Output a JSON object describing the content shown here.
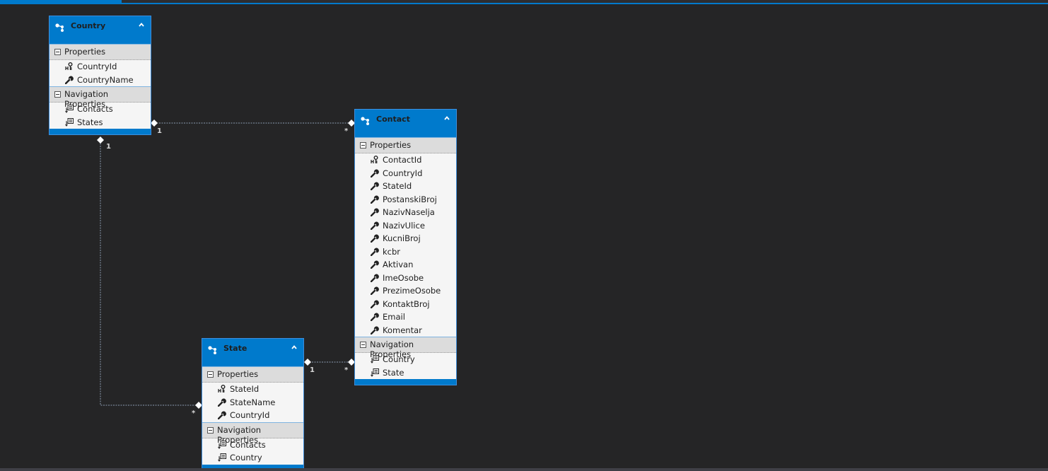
{
  "diagram": {
    "colors": {
      "accent": "#007acc",
      "background": "#252526",
      "entity_body": "#f5f5f5",
      "section_header": "#dcdcdc"
    },
    "section_labels": {
      "properties": "Properties",
      "navigation": "Navigation Properties"
    },
    "entities": {
      "country": {
        "name": "Country",
        "properties": [
          {
            "name": "CountryId",
            "icon": "key-icon"
          },
          {
            "name": "CountryName",
            "icon": "wrench-icon"
          }
        ],
        "navigation": [
          {
            "name": "Contacts",
            "icon": "navigation-property-icon"
          },
          {
            "name": "States",
            "icon": "navigation-property-icon"
          }
        ]
      },
      "contact": {
        "name": "Contact",
        "properties": [
          {
            "name": "ContactId",
            "icon": "key-icon"
          },
          {
            "name": "CountryId",
            "icon": "wrench-icon"
          },
          {
            "name": "StateId",
            "icon": "wrench-icon"
          },
          {
            "name": "PostanskiBroj",
            "icon": "wrench-icon"
          },
          {
            "name": "NazivNaselja",
            "icon": "wrench-icon"
          },
          {
            "name": "NazivUlice",
            "icon": "wrench-icon"
          },
          {
            "name": "KucniBroj",
            "icon": "wrench-icon"
          },
          {
            "name": "kcbr",
            "icon": "wrench-icon"
          },
          {
            "name": "Aktivan",
            "icon": "wrench-icon"
          },
          {
            "name": "ImeOsobe",
            "icon": "wrench-icon"
          },
          {
            "name": "PrezimeOsobe",
            "icon": "wrench-icon"
          },
          {
            "name": "KontaktBroj",
            "icon": "wrench-icon"
          },
          {
            "name": "Email",
            "icon": "wrench-icon"
          },
          {
            "name": "Komentar",
            "icon": "wrench-icon"
          }
        ],
        "navigation": [
          {
            "name": "Country",
            "icon": "navigation-property-icon"
          },
          {
            "name": "State",
            "icon": "navigation-property-icon"
          }
        ]
      },
      "state": {
        "name": "State",
        "properties": [
          {
            "name": "StateId",
            "icon": "key-icon"
          },
          {
            "name": "StateName",
            "icon": "wrench-icon"
          },
          {
            "name": "CountryId",
            "icon": "wrench-icon"
          }
        ],
        "navigation": [
          {
            "name": "Contacts",
            "icon": "navigation-property-icon"
          },
          {
            "name": "Country",
            "icon": "navigation-property-icon"
          }
        ]
      }
    },
    "associations": [
      {
        "from": "Country",
        "to": "Contact",
        "from_multiplicity": "1",
        "to_multiplicity": "*"
      },
      {
        "from": "Country",
        "to": "State",
        "from_multiplicity": "1",
        "to_multiplicity": "*"
      },
      {
        "from": "State",
        "to": "Contact",
        "from_multiplicity": "1",
        "to_multiplicity": "*"
      }
    ]
  }
}
